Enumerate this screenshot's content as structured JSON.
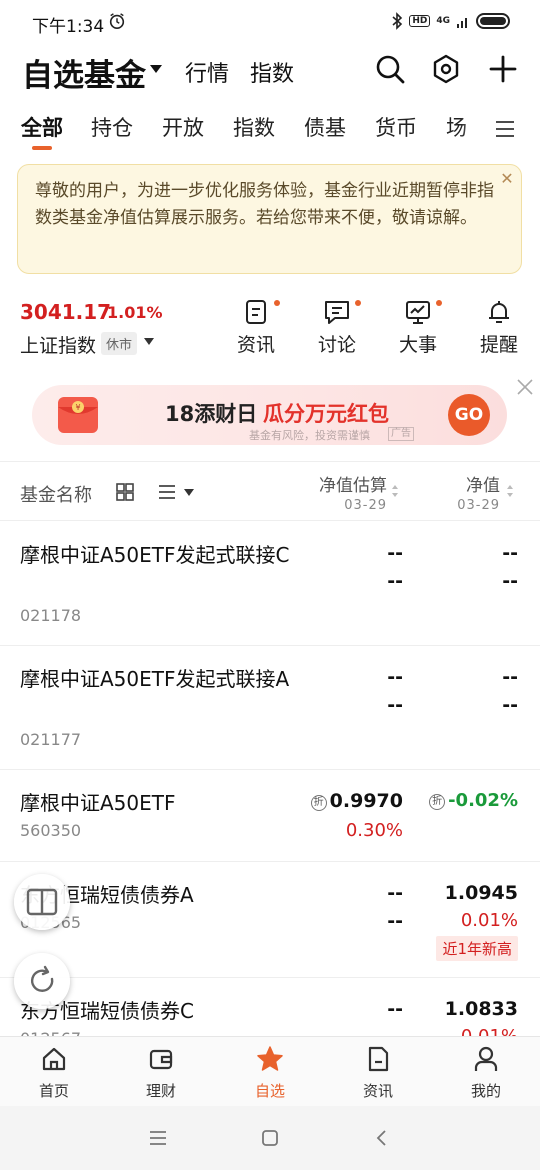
{
  "status_bar": {
    "time": "下午1:34",
    "hd": "HD",
    "signal": "4G"
  },
  "header": {
    "title": "自选基金",
    "nav": [
      "行情",
      "指数"
    ]
  },
  "tabs": [
    "全部",
    "持仓",
    "开放",
    "指数",
    "债基",
    "货币",
    "场"
  ],
  "active_tab": "全部",
  "notice": {
    "text": "尊敬的用户，为进一步优化服务体验，基金行业近期暂停非指数类基金净值估算展示服务。若给您带来不便，敬请谅解。"
  },
  "index": {
    "value": "3041.17",
    "change": "1.01%",
    "name": "上证指数",
    "badge": "休市"
  },
  "quick_actions": [
    {
      "label": "资讯",
      "icon": "news-icon",
      "dot": true
    },
    {
      "label": "讨论",
      "icon": "chat-icon",
      "dot": true
    },
    {
      "label": "大事",
      "icon": "monitor-chart-icon",
      "dot": true
    },
    {
      "label": "提醒",
      "icon": "bell-icon",
      "dot": false
    }
  ],
  "banner": {
    "text_prefix": "18添财日",
    "text_highlight": "瓜分万元红包",
    "button": "GO",
    "disclaimer": "基金有风险，投资需谨慎",
    "ad_tag": "广告"
  },
  "list_header": {
    "name_label": "基金名称",
    "col_estimate": {
      "label": "净值估算",
      "date": "03-29"
    },
    "col_nav": {
      "label": "净值",
      "date": "03-29"
    }
  },
  "funds": [
    {
      "name": "摩根中证A50ETF发起式联接C",
      "code": "021178",
      "est": "--",
      "est_chg": "--",
      "nav": "--",
      "nav_chg": "--"
    },
    {
      "name": "摩根中证A50ETF发起式联接A",
      "code": "021177",
      "est": "--",
      "est_chg": "--",
      "nav": "--",
      "nav_chg": "--"
    },
    {
      "name": "摩根中证A50ETF",
      "code": "560350",
      "est": "0.9970",
      "est_chg": "0.30%",
      "nav": "-0.02%",
      "zhe": "折"
    },
    {
      "name": "东方恒瑞短债债券A",
      "code": "012565",
      "est": "--",
      "est_chg": "--",
      "nav": "1.0945",
      "nav_chg": "0.01%",
      "tag": "近1年新高"
    },
    {
      "name": "东方恒瑞短债债券C",
      "code": "012567",
      "est": "--",
      "nav": "1.0833",
      "nav_chg": "0.01%"
    }
  ],
  "bottom_nav": [
    {
      "label": "首页",
      "icon": "home-icon"
    },
    {
      "label": "理财",
      "icon": "wallet-icon"
    },
    {
      "label": "自选",
      "icon": "star-icon"
    },
    {
      "label": "资讯",
      "icon": "document-icon"
    },
    {
      "label": "我的",
      "icon": "person-icon"
    }
  ],
  "bottom_nav_active": "自选",
  "colors": {
    "accent": "#e8622c",
    "up": "#d32020",
    "down": "#1a9a3a",
    "notice_bg": "#fdf7e1"
  }
}
